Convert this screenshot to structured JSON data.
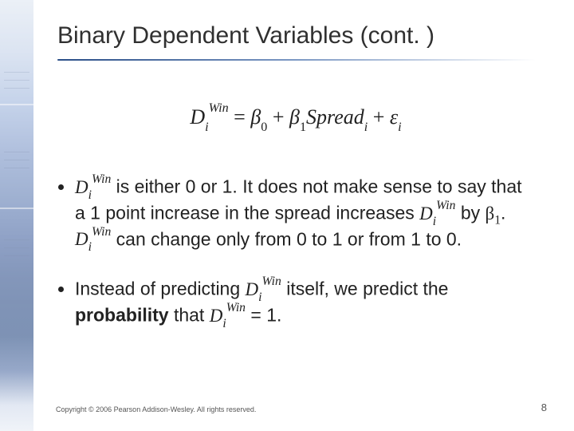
{
  "slide": {
    "title": "Binary Dependent Variables (cont. )",
    "equation": {
      "lhs_base": "D",
      "lhs_sub": "i",
      "lhs_sup": "Win",
      "eq": " = ",
      "b0_sym": "β",
      "b0_sub": "0",
      "plus1": " + ",
      "b1_sym": "β",
      "b1_sub": "1",
      "spread_base": "Spread",
      "spread_sub": "i",
      "plus2": " + ",
      "eps_sym": "ε",
      "eps_sub": "i"
    },
    "bullets": {
      "b1": {
        "pre": " is either 0 or 1. It does not make sense to say that a 1 point increase in the spread increases ",
        "mid1": " by ",
        "mid2": ". ",
        "mid3": " can change only from 0 to 1 or from 1 to 0."
      },
      "b2": {
        "pre": "Instead of predicting ",
        "mid": " itself, we predict the ",
        "bold": "probability",
        "post": " that ",
        "eq": " = 1."
      },
      "var_D": {
        "base": "D",
        "sub": "i",
        "sup": "Win"
      },
      "beta1": {
        "sym": "β",
        "sub": "1"
      }
    },
    "footer": "Copyright © 2006 Pearson Addison-Wesley. All rights reserved.",
    "page_number": "8"
  }
}
